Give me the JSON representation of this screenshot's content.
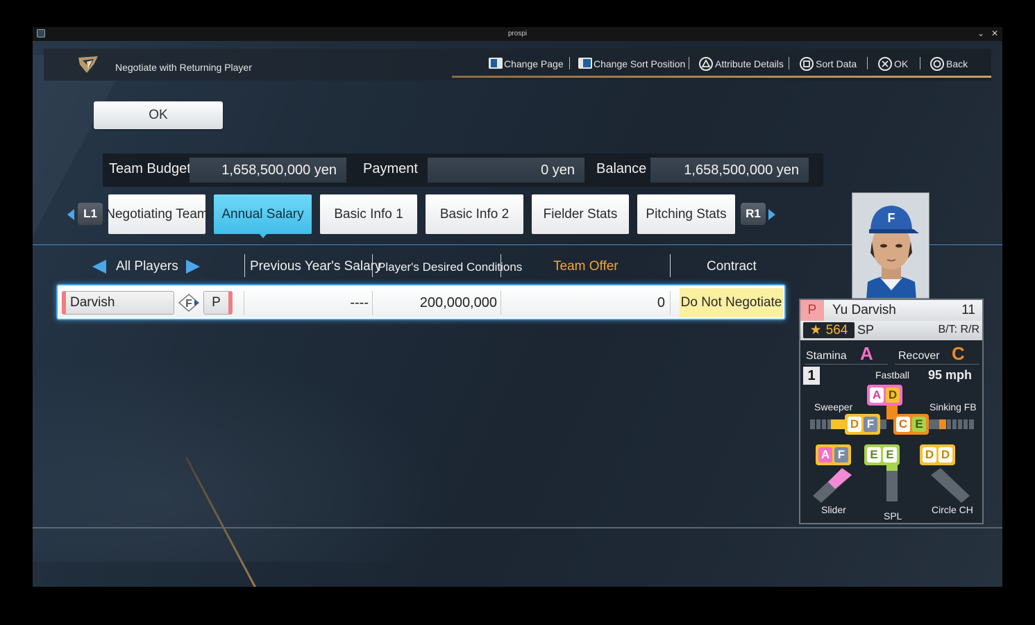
{
  "window": {
    "title": "prospi"
  },
  "header": {
    "title": "Negotiate with Returning Player",
    "hints": [
      {
        "label": "Change Page",
        "icon": "touchpad-icon"
      },
      {
        "label": "Change Sort Position",
        "icon": "touchpad-icon"
      },
      {
        "label": "Attribute Details",
        "icon": "triangle-button-icon"
      },
      {
        "label": "Sort Data",
        "icon": "square-button-icon"
      },
      {
        "label": "OK",
        "icon": "cross-button-icon"
      },
      {
        "label": "Back",
        "icon": "circle-button-icon"
      }
    ]
  },
  "ok_button": "OK",
  "budget": {
    "team_budget_label": "Team Budget",
    "team_budget_value": "1,658,500,000 yen",
    "payment_label": "Payment",
    "payment_value": "0 yen",
    "balance_label": "Balance",
    "balance_value": "1,658,500,000 yen"
  },
  "tabs": {
    "left_shoulder": "L1",
    "right_shoulder": "R1",
    "items": [
      "Negotiating Team",
      "Annual Salary",
      "Basic Info 1",
      "Basic Info 2",
      "Fielder Stats",
      "Pitching Stats"
    ],
    "active": "Annual Salary"
  },
  "columns": {
    "filter": "All Players",
    "prev_salary": "Previous Year's Salary",
    "desired": "Player's Desired Conditions",
    "offer": "Team Offer",
    "contract": "Contract"
  },
  "rows": [
    {
      "name": "Darvish",
      "team_logo": "F",
      "position": "P",
      "prev_salary": "----",
      "desired": "200,000,000",
      "offer": "0",
      "contract": "Do Not Negotiate"
    }
  ],
  "player_card": {
    "position": "P",
    "name": "Yu Darvish",
    "number": "11",
    "overall": "564",
    "role": "SP",
    "bt": "B/T: R/R",
    "stamina_label": "Stamina",
    "stamina_grade": "A",
    "recover_label": "Recover",
    "recover_grade": "C",
    "fastball_rank": "1",
    "fastball_label": "Fastball",
    "fastball_speed": "95 mph",
    "pitches": {
      "fastball": {
        "g1": "A",
        "g2": "D"
      },
      "sweeper": {
        "label": "Sweeper",
        "g1": "D",
        "g2": "F"
      },
      "sinking": {
        "label": "Sinking FB",
        "g1": "C",
        "g2": "E"
      },
      "slider": {
        "label": "Slider",
        "g1": "A",
        "g2": "F"
      },
      "spl": {
        "label": "SPL",
        "g1": "E",
        "g2": "E"
      },
      "circle": {
        "label": "Circle CH",
        "g1": "D",
        "g2": "D"
      }
    }
  },
  "colors": {
    "accent": "#42bde8",
    "offer_header": "#f7a43a",
    "contract_bg": "#faf0a0",
    "grade_A": "#f46fc6",
    "grade_C": "#f2891e"
  }
}
